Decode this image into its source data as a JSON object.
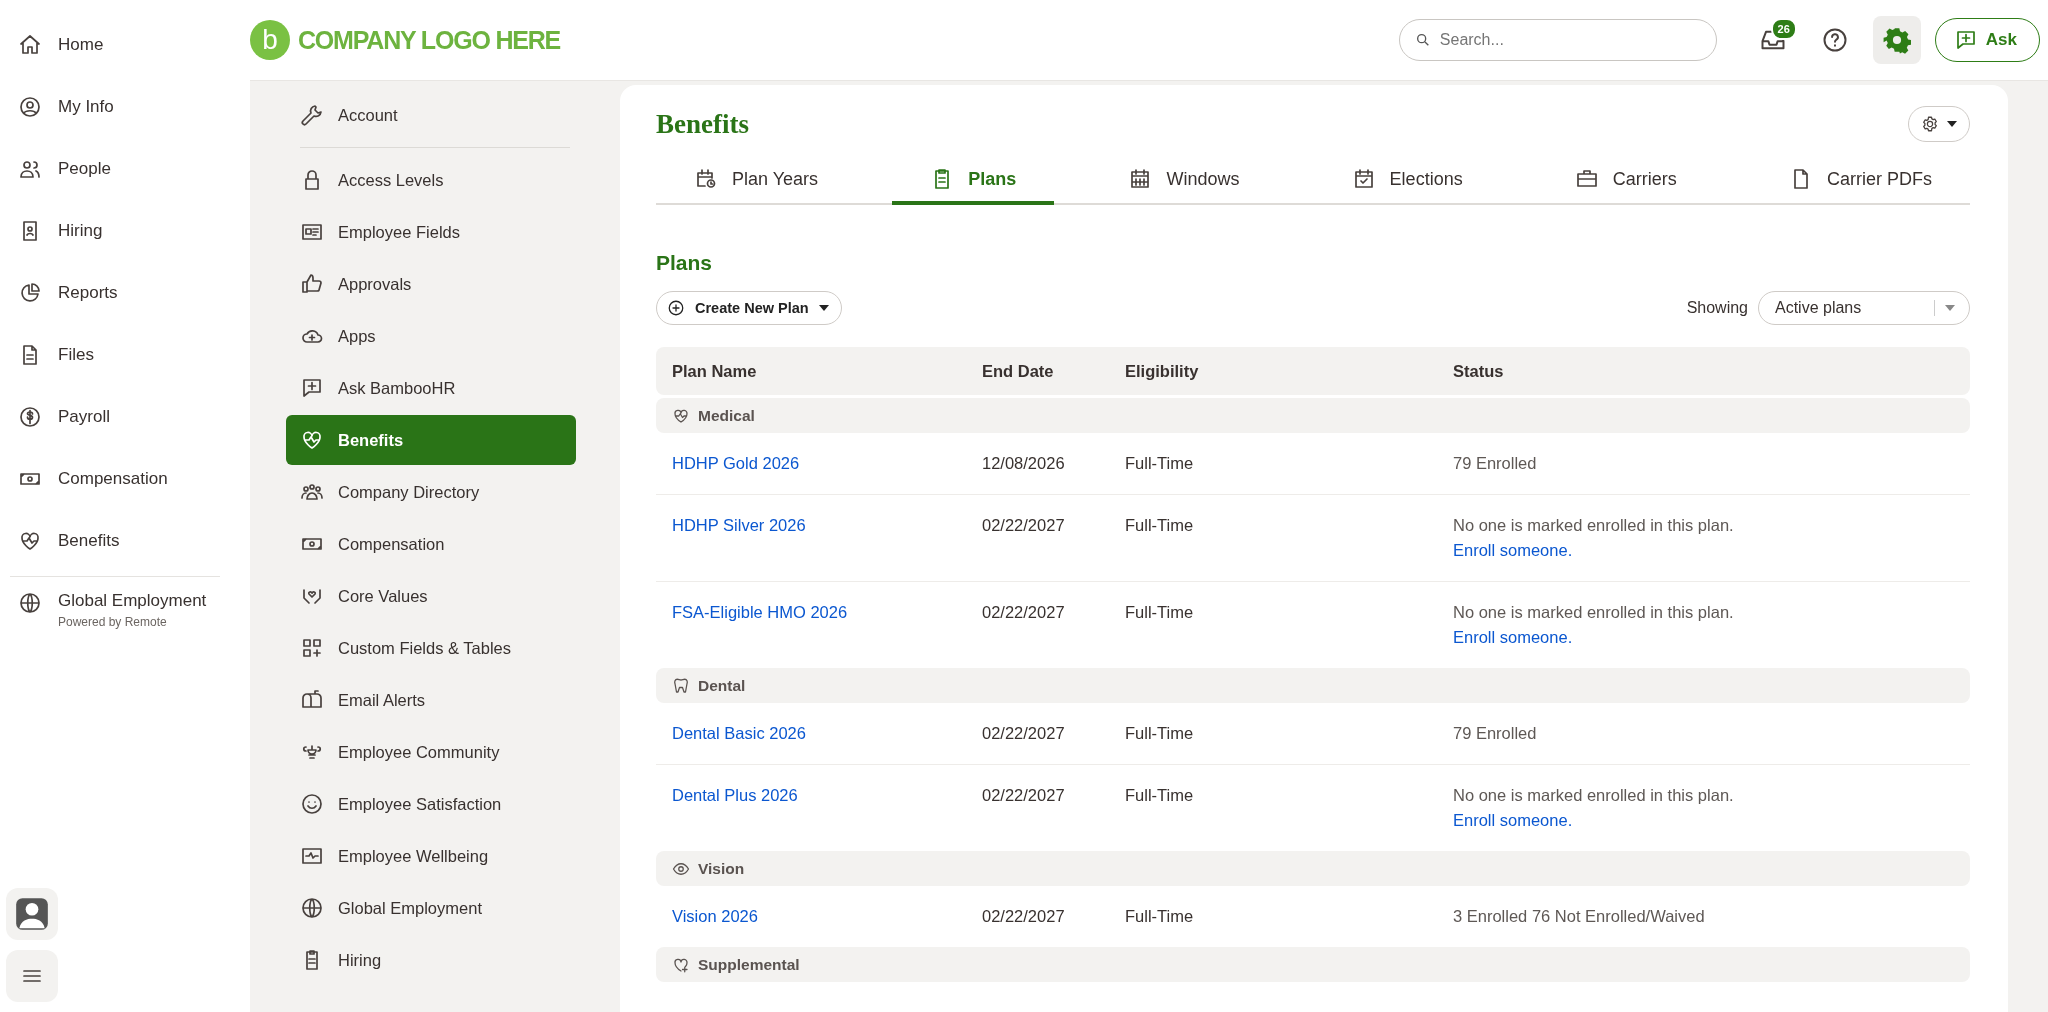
{
  "main_nav": {
    "items": [
      {
        "label": "Home"
      },
      {
        "label": "My Info"
      },
      {
        "label": "People"
      },
      {
        "label": "Hiring"
      },
      {
        "label": "Reports"
      },
      {
        "label": "Files"
      },
      {
        "label": "Payroll"
      },
      {
        "label": "Compensation"
      },
      {
        "label": "Benefits"
      }
    ],
    "extra": {
      "label": "Global Employment",
      "sublabel": "Powered by Remote"
    }
  },
  "logo": {
    "mark": "b",
    "text": "COMPANY LOGO HERE"
  },
  "top_bar": {
    "search": {
      "placeholder": "Search..."
    },
    "inbox_badge": "26",
    "ask_button": "Ask"
  },
  "settings_menu": {
    "account": "Account",
    "items": [
      {
        "label": "Access Levels",
        "selected": false
      },
      {
        "label": "Employee Fields",
        "selected": false
      },
      {
        "label": "Approvals",
        "selected": false
      },
      {
        "label": "Apps",
        "selected": false
      },
      {
        "label": "Ask BambooHR",
        "selected": false
      },
      {
        "label": "Benefits",
        "selected": true
      },
      {
        "label": "Company Directory",
        "selected": false
      },
      {
        "label": "Compensation",
        "selected": false
      },
      {
        "label": "Core Values",
        "selected": false
      },
      {
        "label": "Custom Fields & Tables",
        "selected": false
      },
      {
        "label": "Email Alerts",
        "selected": false
      },
      {
        "label": "Employee Community",
        "selected": false
      },
      {
        "label": "Employee Satisfaction",
        "selected": false
      },
      {
        "label": "Employee Wellbeing",
        "selected": false
      },
      {
        "label": "Global Employment",
        "selected": false
      },
      {
        "label": "Hiring",
        "selected": false
      }
    ]
  },
  "page": {
    "title": "Benefits",
    "tabs": [
      {
        "label": "Plan Years",
        "selected": false
      },
      {
        "label": "Plans",
        "selected": true
      },
      {
        "label": "Windows",
        "selected": false
      },
      {
        "label": "Elections",
        "selected": false
      },
      {
        "label": "Carriers",
        "selected": false
      },
      {
        "label": "Carrier PDFs",
        "selected": false
      }
    ],
    "section_title": "Plans",
    "create_button": "Create New Plan",
    "showing_label": "Showing",
    "filter": {
      "value": "Active plans"
    },
    "table": {
      "columns": [
        "Plan Name",
        "End Date",
        "Eligibility",
        "Status"
      ],
      "groups": [
        {
          "label": "Medical",
          "rows": [
            {
              "name": "HDHP Gold 2026",
              "end_date": "12/08/2026",
              "eligibility": "Full-Time",
              "status": "79 Enrolled"
            },
            {
              "name": "HDHP Silver 2026",
              "end_date": "02/22/2027",
              "eligibility": "Full-Time",
              "status": "No one is marked enrolled in this plan.",
              "action": "Enroll someone."
            },
            {
              "name": "FSA-Eligible HMO 2026",
              "end_date": "02/22/2027",
              "eligibility": "Full-Time",
              "status": "No one is marked enrolled in this plan.",
              "action": "Enroll someone."
            }
          ]
        },
        {
          "label": "Dental",
          "rows": [
            {
              "name": "Dental Basic 2026",
              "end_date": "02/22/2027",
              "eligibility": "Full-Time",
              "status": "79 Enrolled"
            },
            {
              "name": "Dental Plus 2026",
              "end_date": "02/22/2027",
              "eligibility": "Full-Time",
              "status": "No one is marked enrolled in this plan.",
              "action": "Enroll someone."
            }
          ]
        },
        {
          "label": "Vision",
          "rows": [
            {
              "name": "Vision 2026",
              "end_date": "02/22/2027",
              "eligibility": "Full-Time",
              "status": "3 Enrolled 76 Not Enrolled/Waived"
            }
          ]
        },
        {
          "label": "Supplemental"
        }
      ]
    }
  }
}
